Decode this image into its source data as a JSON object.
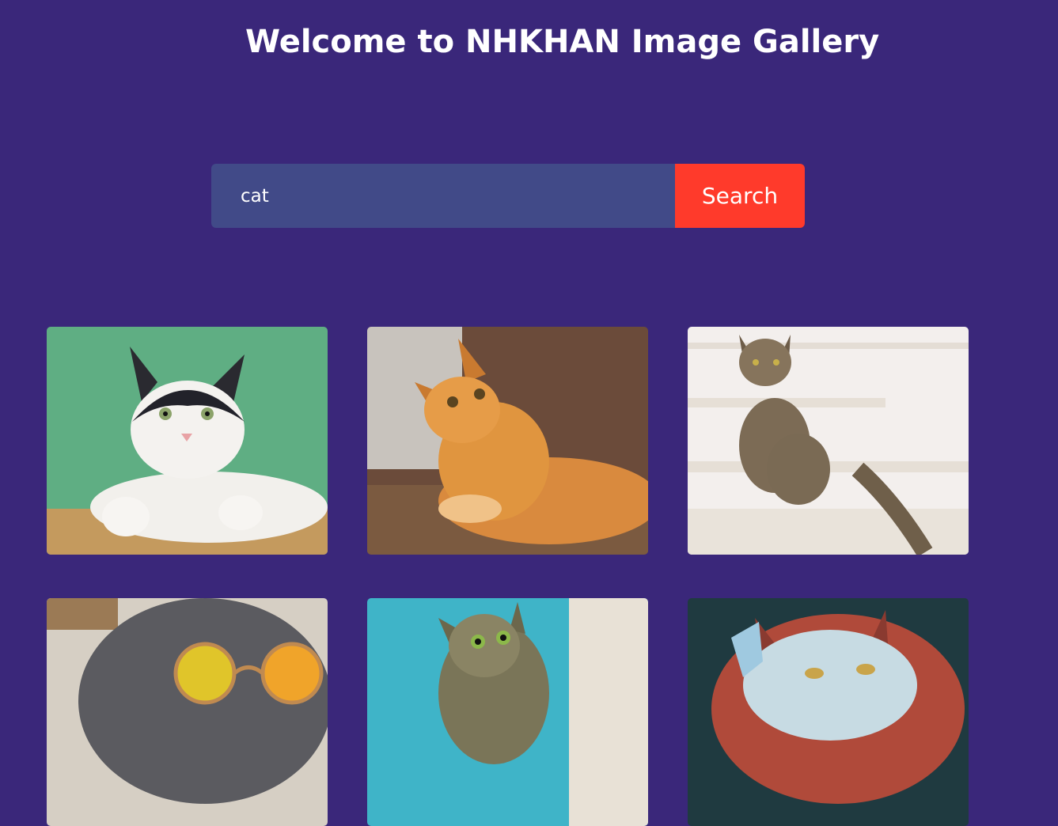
{
  "header": {
    "title": "Welcome to NHKHAN Image Gallery"
  },
  "search": {
    "query": "cat",
    "button_label": "Search"
  },
  "colors": {
    "background": "#3a277a",
    "input_bg": "#414a88",
    "button_bg": "#ff3a2b"
  },
  "gallery": {
    "images": [
      {
        "subject": "black-and-white-cat-on-green"
      },
      {
        "subject": "orange-tabby-cat-lying"
      },
      {
        "subject": "tabby-cat-on-stairs"
      },
      {
        "subject": "gray-cat-with-sunglasses"
      },
      {
        "subject": "tabby-cat-peeking"
      },
      {
        "subject": "cat-with-butterfly"
      }
    ]
  }
}
